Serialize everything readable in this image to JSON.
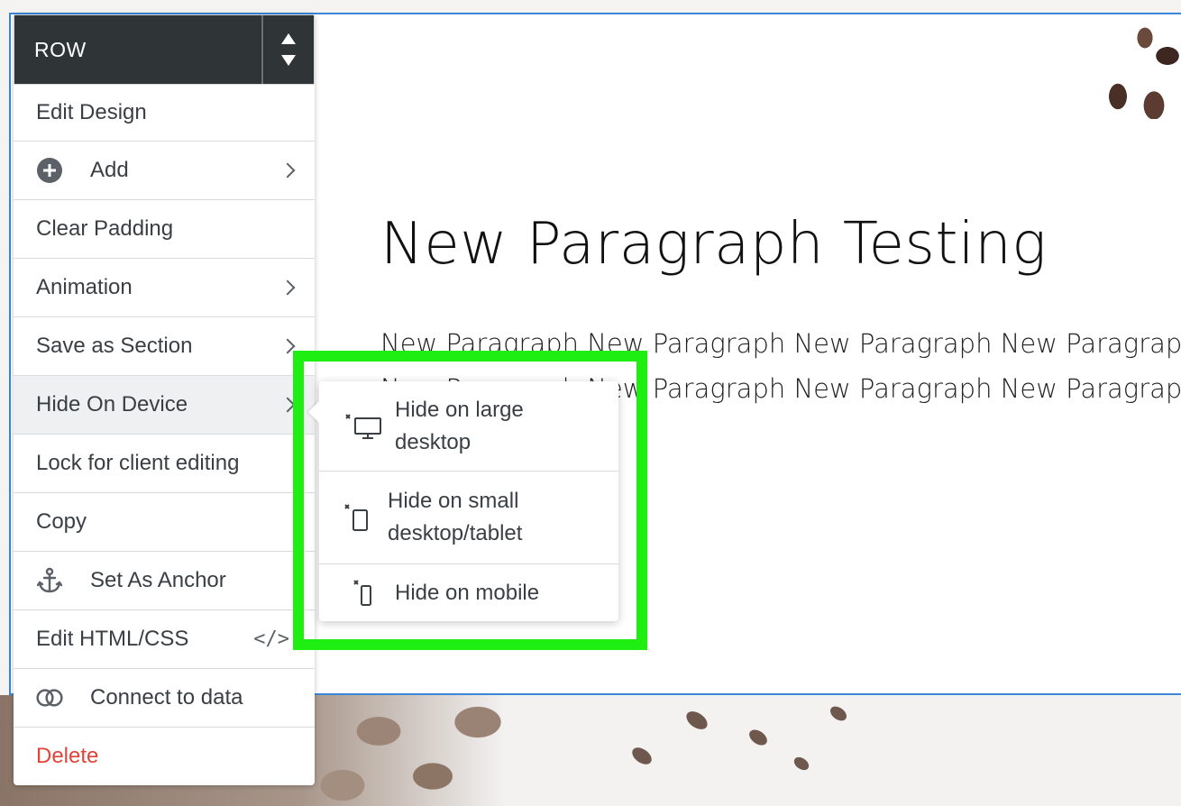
{
  "canvas": {
    "heading": "New Paragraph Testing",
    "paragraph": "New Paragraph New Paragraph New Paragraph New Paragraph New Paragraph New Paragraph New Paragraph New Paragraph New Paragraph"
  },
  "menu": {
    "header_title": "ROW",
    "items": [
      {
        "label": "Edit Design"
      },
      {
        "label": "Add",
        "icon": "plus-circle-icon"
      },
      {
        "label": "Clear Padding"
      },
      {
        "label": "Animation"
      },
      {
        "label": "Save as Section"
      },
      {
        "label": "Hide On Device"
      },
      {
        "label": "Lock for client editing"
      },
      {
        "label": "Copy"
      },
      {
        "label": "Set As Anchor",
        "icon": "anchor-icon"
      },
      {
        "label": "Edit HTML/CSS",
        "icon": "code-icon"
      },
      {
        "label": "Connect to data",
        "icon": "link-rings-icon"
      },
      {
        "label": "Delete"
      }
    ]
  },
  "submenu": {
    "items": [
      {
        "label": "Hide on large\ndesktop",
        "icon": "desktop-icon"
      },
      {
        "label": "Hide on small\ndesktop/tablet",
        "icon": "tablet-icon"
      },
      {
        "label": "Hide on mobile",
        "icon": "mobile-icon"
      }
    ]
  },
  "colors": {
    "menu_header_bg": "#2f3437",
    "selection_border": "#3b86d8",
    "delete_text": "#e0443a",
    "highlight": "#1fee12"
  }
}
